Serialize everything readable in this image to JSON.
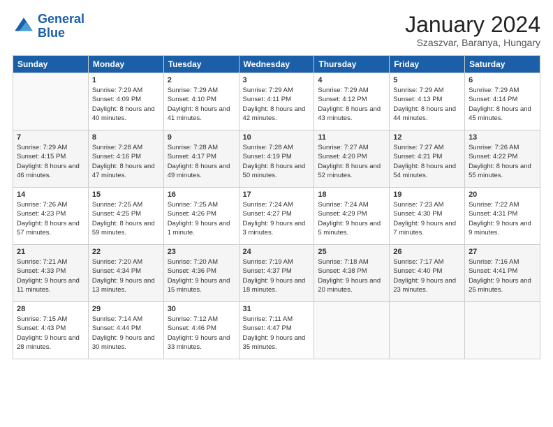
{
  "logo": {
    "line1": "General",
    "line2": "Blue"
  },
  "title": "January 2024",
  "subtitle": "Szaszvar, Baranya, Hungary",
  "days_header": [
    "Sunday",
    "Monday",
    "Tuesday",
    "Wednesday",
    "Thursday",
    "Friday",
    "Saturday"
  ],
  "weeks": [
    [
      {
        "day": "",
        "sunrise": "",
        "sunset": "",
        "daylight": ""
      },
      {
        "day": "1",
        "sunrise": "Sunrise: 7:29 AM",
        "sunset": "Sunset: 4:09 PM",
        "daylight": "Daylight: 8 hours and 40 minutes."
      },
      {
        "day": "2",
        "sunrise": "Sunrise: 7:29 AM",
        "sunset": "Sunset: 4:10 PM",
        "daylight": "Daylight: 8 hours and 41 minutes."
      },
      {
        "day": "3",
        "sunrise": "Sunrise: 7:29 AM",
        "sunset": "Sunset: 4:11 PM",
        "daylight": "Daylight: 8 hours and 42 minutes."
      },
      {
        "day": "4",
        "sunrise": "Sunrise: 7:29 AM",
        "sunset": "Sunset: 4:12 PM",
        "daylight": "Daylight: 8 hours and 43 minutes."
      },
      {
        "day": "5",
        "sunrise": "Sunrise: 7:29 AM",
        "sunset": "Sunset: 4:13 PM",
        "daylight": "Daylight: 8 hours and 44 minutes."
      },
      {
        "day": "6",
        "sunrise": "Sunrise: 7:29 AM",
        "sunset": "Sunset: 4:14 PM",
        "daylight": "Daylight: 8 hours and 45 minutes."
      }
    ],
    [
      {
        "day": "7",
        "sunrise": "Sunrise: 7:29 AM",
        "sunset": "Sunset: 4:15 PM",
        "daylight": "Daylight: 8 hours and 46 minutes."
      },
      {
        "day": "8",
        "sunrise": "Sunrise: 7:28 AM",
        "sunset": "Sunset: 4:16 PM",
        "daylight": "Daylight: 8 hours and 47 minutes."
      },
      {
        "day": "9",
        "sunrise": "Sunrise: 7:28 AM",
        "sunset": "Sunset: 4:17 PM",
        "daylight": "Daylight: 8 hours and 49 minutes."
      },
      {
        "day": "10",
        "sunrise": "Sunrise: 7:28 AM",
        "sunset": "Sunset: 4:19 PM",
        "daylight": "Daylight: 8 hours and 50 minutes."
      },
      {
        "day": "11",
        "sunrise": "Sunrise: 7:27 AM",
        "sunset": "Sunset: 4:20 PM",
        "daylight": "Daylight: 8 hours and 52 minutes."
      },
      {
        "day": "12",
        "sunrise": "Sunrise: 7:27 AM",
        "sunset": "Sunset: 4:21 PM",
        "daylight": "Daylight: 8 hours and 54 minutes."
      },
      {
        "day": "13",
        "sunrise": "Sunrise: 7:26 AM",
        "sunset": "Sunset: 4:22 PM",
        "daylight": "Daylight: 8 hours and 55 minutes."
      }
    ],
    [
      {
        "day": "14",
        "sunrise": "Sunrise: 7:26 AM",
        "sunset": "Sunset: 4:23 PM",
        "daylight": "Daylight: 8 hours and 57 minutes."
      },
      {
        "day": "15",
        "sunrise": "Sunrise: 7:25 AM",
        "sunset": "Sunset: 4:25 PM",
        "daylight": "Daylight: 8 hours and 59 minutes."
      },
      {
        "day": "16",
        "sunrise": "Sunrise: 7:25 AM",
        "sunset": "Sunset: 4:26 PM",
        "daylight": "Daylight: 9 hours and 1 minute."
      },
      {
        "day": "17",
        "sunrise": "Sunrise: 7:24 AM",
        "sunset": "Sunset: 4:27 PM",
        "daylight": "Daylight: 9 hours and 3 minutes."
      },
      {
        "day": "18",
        "sunrise": "Sunrise: 7:24 AM",
        "sunset": "Sunset: 4:29 PM",
        "daylight": "Daylight: 9 hours and 5 minutes."
      },
      {
        "day": "19",
        "sunrise": "Sunrise: 7:23 AM",
        "sunset": "Sunset: 4:30 PM",
        "daylight": "Daylight: 9 hours and 7 minutes."
      },
      {
        "day": "20",
        "sunrise": "Sunrise: 7:22 AM",
        "sunset": "Sunset: 4:31 PM",
        "daylight": "Daylight: 9 hours and 9 minutes."
      }
    ],
    [
      {
        "day": "21",
        "sunrise": "Sunrise: 7:21 AM",
        "sunset": "Sunset: 4:33 PM",
        "daylight": "Daylight: 9 hours and 11 minutes."
      },
      {
        "day": "22",
        "sunrise": "Sunrise: 7:20 AM",
        "sunset": "Sunset: 4:34 PM",
        "daylight": "Daylight: 9 hours and 13 minutes."
      },
      {
        "day": "23",
        "sunrise": "Sunrise: 7:20 AM",
        "sunset": "Sunset: 4:36 PM",
        "daylight": "Daylight: 9 hours and 15 minutes."
      },
      {
        "day": "24",
        "sunrise": "Sunrise: 7:19 AM",
        "sunset": "Sunset: 4:37 PM",
        "daylight": "Daylight: 9 hours and 18 minutes."
      },
      {
        "day": "25",
        "sunrise": "Sunrise: 7:18 AM",
        "sunset": "Sunset: 4:38 PM",
        "daylight": "Daylight: 9 hours and 20 minutes."
      },
      {
        "day": "26",
        "sunrise": "Sunrise: 7:17 AM",
        "sunset": "Sunset: 4:40 PM",
        "daylight": "Daylight: 9 hours and 23 minutes."
      },
      {
        "day": "27",
        "sunrise": "Sunrise: 7:16 AM",
        "sunset": "Sunset: 4:41 PM",
        "daylight": "Daylight: 9 hours and 25 minutes."
      }
    ],
    [
      {
        "day": "28",
        "sunrise": "Sunrise: 7:15 AM",
        "sunset": "Sunset: 4:43 PM",
        "daylight": "Daylight: 9 hours and 28 minutes."
      },
      {
        "day": "29",
        "sunrise": "Sunrise: 7:14 AM",
        "sunset": "Sunset: 4:44 PM",
        "daylight": "Daylight: 9 hours and 30 minutes."
      },
      {
        "day": "30",
        "sunrise": "Sunrise: 7:12 AM",
        "sunset": "Sunset: 4:46 PM",
        "daylight": "Daylight: 9 hours and 33 minutes."
      },
      {
        "day": "31",
        "sunrise": "Sunrise: 7:11 AM",
        "sunset": "Sunset: 4:47 PM",
        "daylight": "Daylight: 9 hours and 35 minutes."
      },
      {
        "day": "",
        "sunrise": "",
        "sunset": "",
        "daylight": ""
      },
      {
        "day": "",
        "sunrise": "",
        "sunset": "",
        "daylight": ""
      },
      {
        "day": "",
        "sunrise": "",
        "sunset": "",
        "daylight": ""
      }
    ]
  ]
}
